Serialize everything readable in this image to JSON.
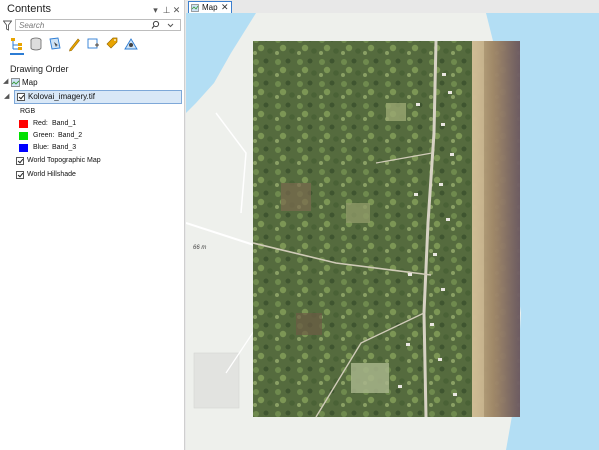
{
  "contents_pane": {
    "title": "Contents",
    "search_placeholder": "Search",
    "drawing_order_heading": "Drawing Order",
    "toolbar_icons": [
      "list-by-drawing-order-icon",
      "list-by-data-source-icon",
      "list-by-selection-icon",
      "list-by-editing-icon",
      "list-by-snapping-icon",
      "list-by-labeling-icon",
      "list-by-perspective-imagery-icon"
    ],
    "tree": {
      "map_label": "Map",
      "imagery_layer": "Kolovai_imagery.tif",
      "rgb_label": "RGB",
      "bands": [
        {
          "channel": "Red:",
          "band": "Band_1",
          "color": "#ff0000"
        },
        {
          "channel": "Green:",
          "band": "Band_2",
          "color": "#00e000"
        },
        {
          "channel": "Blue:",
          "band": "Band_3",
          "color": "#0000ff"
        }
      ],
      "basemap_layers": [
        "World Topographic Map",
        "World Hillshade"
      ]
    }
  },
  "map_view": {
    "tab_label": "Map",
    "scale_label": "66 m"
  },
  "colors": {
    "accent": "#2c7cd4",
    "water": "#b3def4",
    "land": "#eef0ec",
    "selection": "#d9e8f7"
  }
}
